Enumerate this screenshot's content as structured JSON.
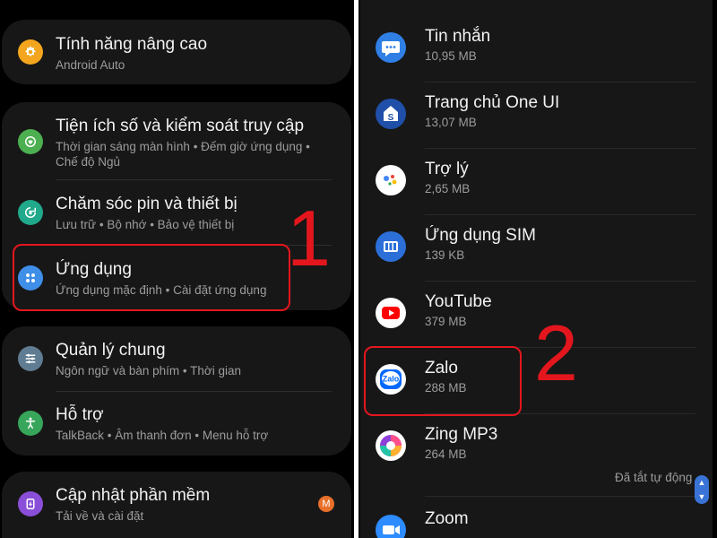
{
  "settings": {
    "advanced": {
      "title": "Tính năng nâng cao",
      "subtitle": "Android Auto"
    },
    "wellbeing": {
      "title": "Tiện ích số và kiểm soát truy cập",
      "subtitle_line1": "Thời gian sáng màn hình  •  Đếm giờ ứng dụng  •",
      "subtitle_line2": "Chế độ Ngủ"
    },
    "battery": {
      "title": "Chăm sóc pin và thiết bị",
      "subtitle": "Lưu trữ  •  Bộ nhớ  •  Bảo vệ thiết bị"
    },
    "apps": {
      "title": "Ứng dụng",
      "subtitle": "Ứng dụng mặc định  •  Cài đặt ứng dụng"
    },
    "general": {
      "title": "Quản lý chung",
      "subtitle": "Ngôn ngữ và bàn phím  •  Thời gian"
    },
    "accessibility": {
      "title": "Hỗ trợ",
      "subtitle": "TalkBack  •  Âm thanh đơn  •  Menu hỗ trợ"
    },
    "update": {
      "title": "Cập nhật phần mềm",
      "subtitle": "Tải về và cài đặt",
      "badge": "M"
    }
  },
  "step_labels": {
    "one": "1",
    "two": "2"
  },
  "apps": [
    {
      "name": "Tin nhắn",
      "size": "10,95 MB",
      "icon": "messages-icon",
      "color": "#2f7fe5"
    },
    {
      "name": "Trang chủ One UI",
      "size": "13,07 MB",
      "icon": "oneui-home-icon",
      "color": "#1f4fa8"
    },
    {
      "name": "Trợ lý",
      "size": "2,65 MB",
      "icon": "assistant-icon",
      "color": "#ffffff"
    },
    {
      "name": "Ứng dụng SIM",
      "size": "139 KB",
      "icon": "sim-icon",
      "color": "#2c6fd9"
    },
    {
      "name": "YouTube",
      "size": "379 MB",
      "icon": "youtube-icon",
      "color": "#ffffff"
    },
    {
      "name": "Zalo",
      "size": "288 MB",
      "icon": "zalo-icon",
      "color": "#0068ff"
    },
    {
      "name": "Zing MP3",
      "size": "264 MB",
      "status": "Đã tắt tự động",
      "icon": "zing-mp3-icon",
      "color": "#ffffff"
    },
    {
      "name": "Zoom",
      "icon": "zoom-icon",
      "color": "#2d8cff"
    }
  ],
  "colors": {
    "highlight": "#e4161d",
    "card": "#171717",
    "background": "#000000"
  }
}
